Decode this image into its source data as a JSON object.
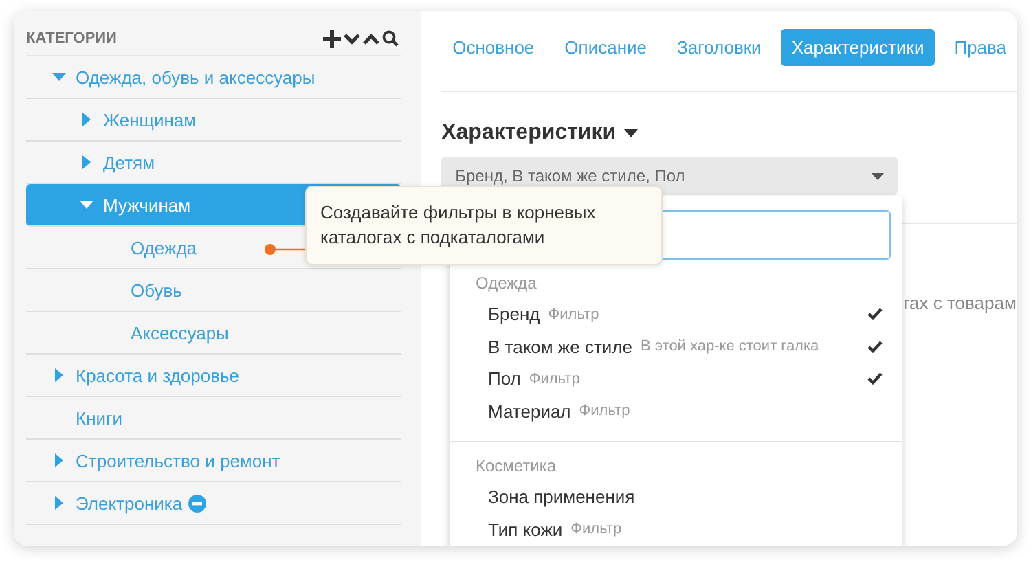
{
  "sidebar": {
    "title": "КАТЕГОРИИ",
    "tree": [
      {
        "label": "Одежда, обувь и аксессуары",
        "kind": "open",
        "selected": false,
        "blocked": false,
        "children": [
          {
            "label": "Женщинам",
            "kind": "closed",
            "selected": false,
            "blocked": false
          },
          {
            "label": "Детям",
            "kind": "closed",
            "selected": false,
            "blocked": false
          },
          {
            "label": "Мужчинам",
            "kind": "open",
            "selected": true,
            "blocked": false,
            "children": [
              {
                "label": "Одежда",
                "kind": "leaf",
                "selected": false,
                "blocked": false
              },
              {
                "label": "Обувь",
                "kind": "leaf",
                "selected": false,
                "blocked": false
              },
              {
                "label": "Аксессуары",
                "kind": "leaf",
                "selected": false,
                "blocked": false
              }
            ]
          }
        ]
      },
      {
        "label": "Красота и здоровье",
        "kind": "closed",
        "selected": false,
        "blocked": false
      },
      {
        "label": "Книги",
        "kind": "leaf",
        "selected": false,
        "blocked": false
      },
      {
        "label": "Строительство и ремонт",
        "kind": "closed",
        "selected": false,
        "blocked": false
      },
      {
        "label": "Электроника",
        "kind": "closed",
        "selected": false,
        "blocked": true
      }
    ]
  },
  "tabs": [
    {
      "label": "Основное",
      "selected": false
    },
    {
      "label": "Описание",
      "selected": false
    },
    {
      "label": "Заголовки",
      "selected": false
    },
    {
      "label": "Характеристики",
      "selected": true
    },
    {
      "label": "Права",
      "selected": false
    }
  ],
  "section": {
    "title": "Характеристики",
    "select_value": "Бренд, В таком же стиле, Пол",
    "background_text": "гах с товарам"
  },
  "dropdown": {
    "groups": [
      {
        "title": "Одежда",
        "items": [
          {
            "name": "Бренд",
            "note": "Фильтр",
            "checked": true
          },
          {
            "name": "В таком же стиле",
            "note": "В этой хар-ке стоит галка",
            "checked": true
          },
          {
            "name": "Пол",
            "note": "Фильтр",
            "checked": true
          },
          {
            "name": "Материал",
            "note": "Фильтр",
            "checked": false
          }
        ]
      },
      {
        "title": "Косметика",
        "items": [
          {
            "name": "Зона применения",
            "checked": false
          },
          {
            "name": "Тип кожи",
            "note": "Фильтр",
            "checked": false
          }
        ]
      }
    ]
  },
  "tooltip": {
    "text": "Создавайте фильтры в корневых\nкаталогах с подкаталогами"
  }
}
